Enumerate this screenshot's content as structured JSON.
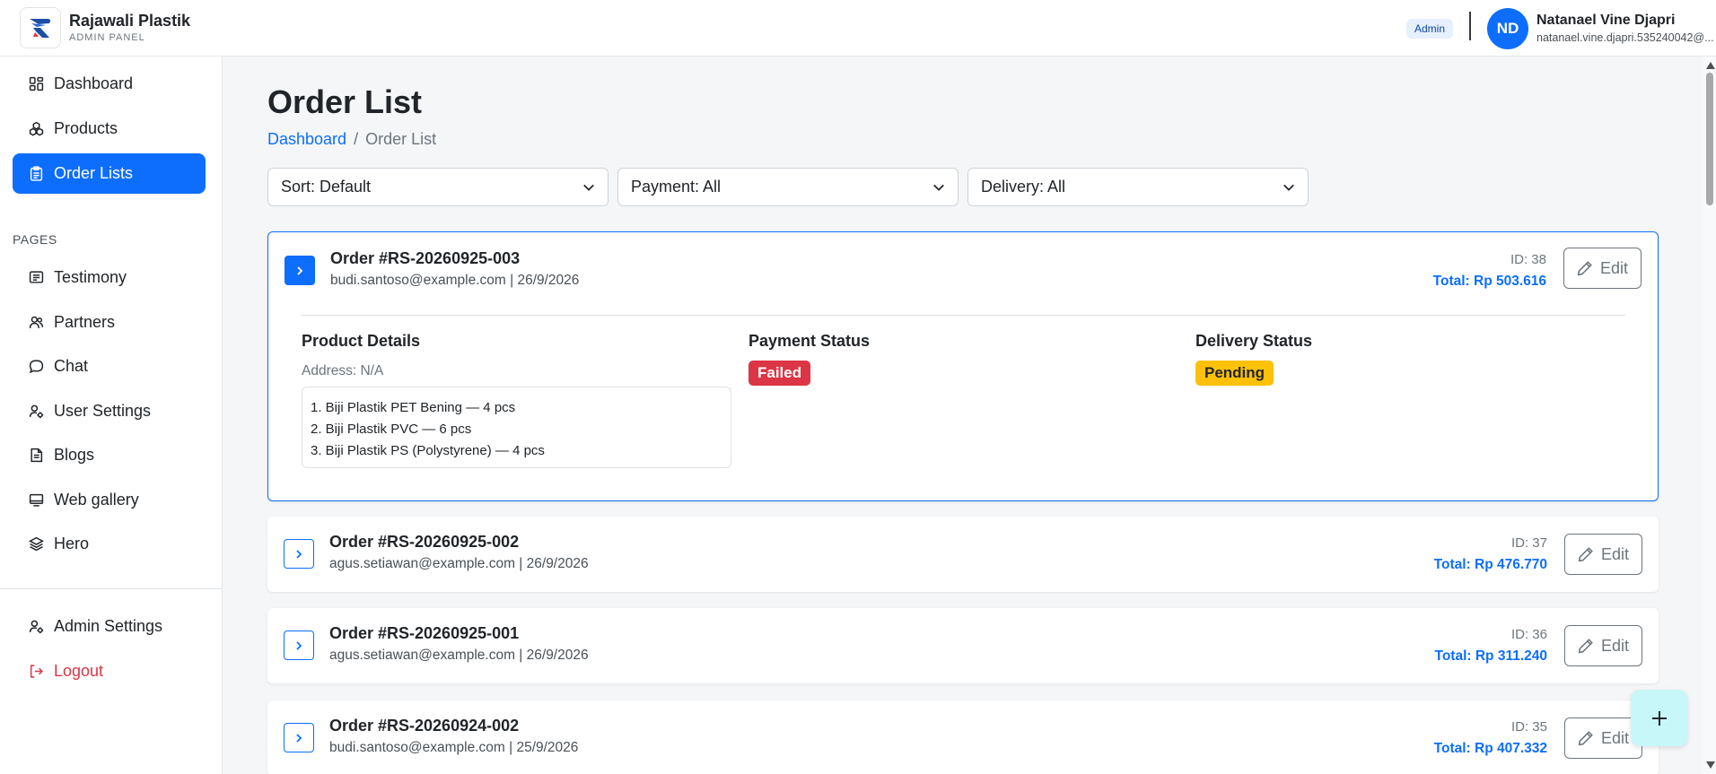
{
  "brand": {
    "name": "Rajawali Plastik",
    "subtitle": "ADMIN PANEL"
  },
  "header": {
    "role_badge": "Admin",
    "user": {
      "initials": "ND",
      "name": "Natanael Vine Djapri",
      "email": "natanael.vine.djapri.535240042@..."
    }
  },
  "sidebar": {
    "main_items": [
      {
        "label": "Dashboard",
        "icon": "dashboard-icon"
      },
      {
        "label": "Products",
        "icon": "products-icon"
      },
      {
        "label": "Order Lists",
        "icon": "clipboard-icon",
        "active": true
      }
    ],
    "section_label": "PAGES",
    "page_items": [
      {
        "label": "Testimony",
        "icon": "testimony-icon"
      },
      {
        "label": "Partners",
        "icon": "partners-icon"
      },
      {
        "label": "Chat",
        "icon": "chat-icon"
      },
      {
        "label": "User Settings",
        "icon": "user-settings-icon"
      },
      {
        "label": "Blogs",
        "icon": "blogs-icon"
      },
      {
        "label": "Web gallery",
        "icon": "gallery-icon"
      },
      {
        "label": "Hero",
        "icon": "layers-icon"
      }
    ],
    "bottom_items": [
      {
        "label": "Admin Settings",
        "icon": "admin-settings-icon"
      },
      {
        "label": "Logout",
        "icon": "logout-icon"
      }
    ]
  },
  "page": {
    "title": "Order List",
    "breadcrumb": {
      "home": "Dashboard",
      "separator": "/",
      "current": "Order List"
    }
  },
  "filters": {
    "sort": "Sort: Default",
    "payment": "Payment: All",
    "delivery": "Delivery: All"
  },
  "edit_label": "Edit",
  "details_labels": {
    "product": "Product Details",
    "payment": "Payment Status",
    "delivery": "Delivery Status"
  },
  "orders": [
    {
      "title": "Order #RS-20260925-003",
      "subtitle": "budi.santoso@example.com | 26/9/2026",
      "id_label": "ID: 38",
      "total_label": "Total: Rp 503.616",
      "expanded": true,
      "address": "Address: N/A",
      "items": [
        "1. Biji Plastik PET Bening — 4 pcs",
        "2. Biji Plastik PVC — 6 pcs",
        "3. Biji Plastik PS (Polystyrene) — 4 pcs"
      ],
      "payment_status": "Failed",
      "delivery_status": "Pending"
    },
    {
      "title": "Order #RS-20260925-002",
      "subtitle": "agus.setiawan@example.com | 26/9/2026",
      "id_label": "ID: 37",
      "total_label": "Total: Rp 476.770"
    },
    {
      "title": "Order #RS-20260925-001",
      "subtitle": "agus.setiawan@example.com | 26/9/2026",
      "id_label": "ID: 36",
      "total_label": "Total: Rp 311.240"
    },
    {
      "title": "Order #RS-20260924-002",
      "subtitle": "budi.santoso@example.com | 25/9/2026",
      "id_label": "ID: 35",
      "total_label": "Total: Rp 407.332"
    }
  ],
  "colors": {
    "primary": "#0d6efd",
    "danger": "#dc3545",
    "warning": "#ffc107",
    "fab": "#c8f7f9"
  },
  "fab_icon": "plus-icon"
}
